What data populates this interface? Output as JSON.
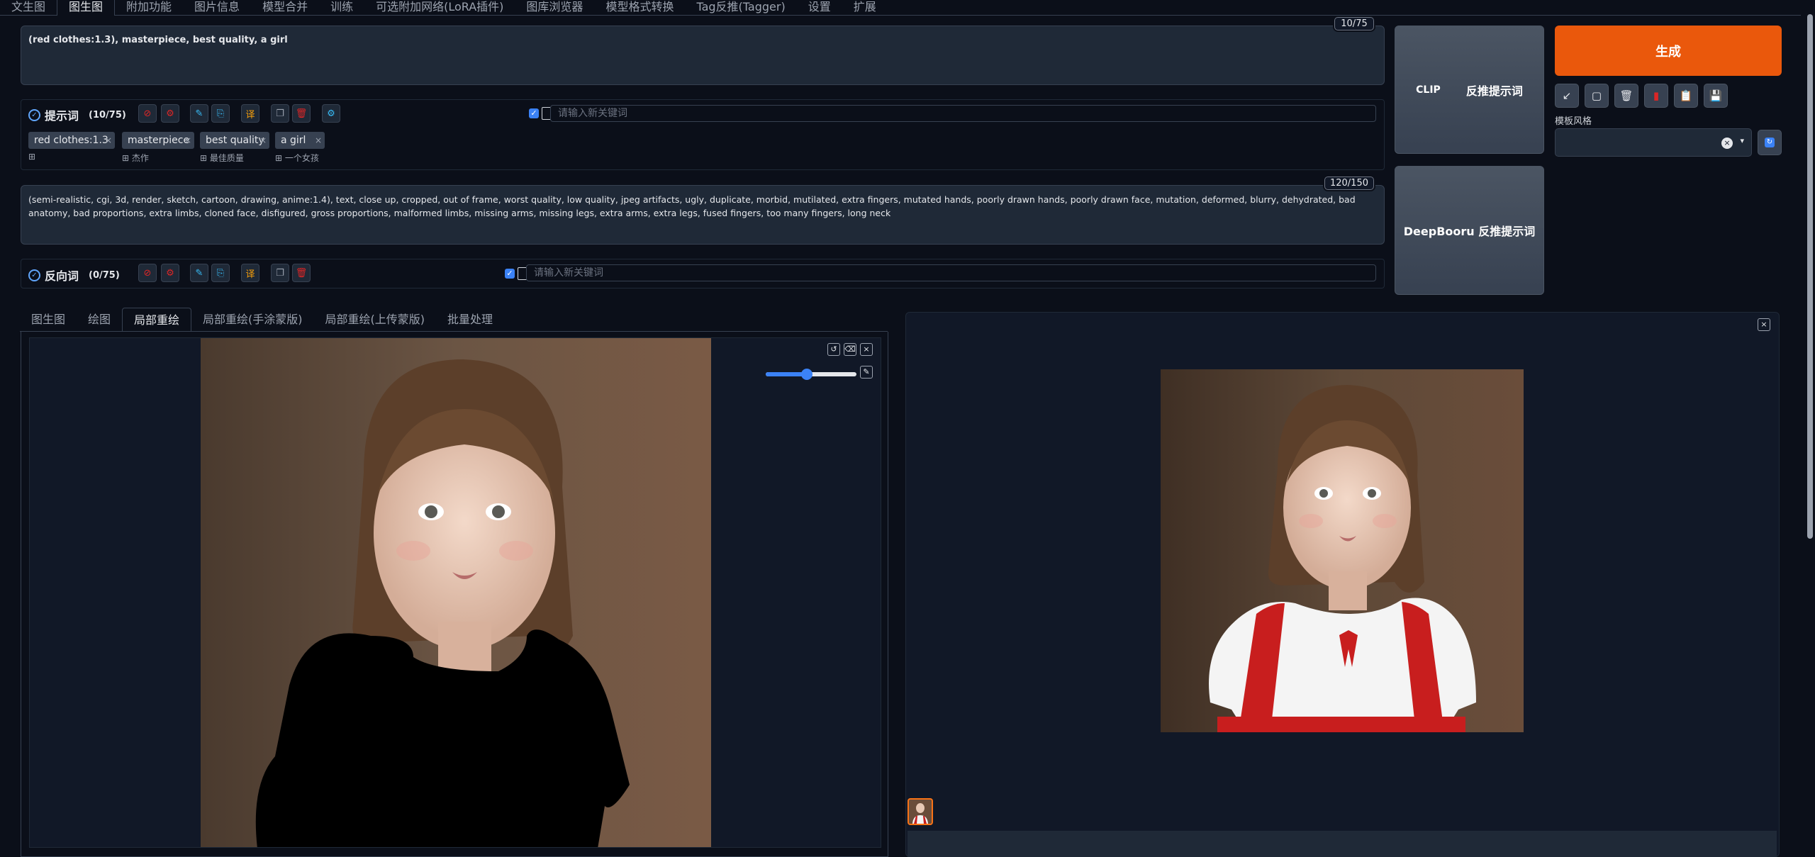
{
  "nav": {
    "tabs": [
      "文生图",
      "图生图",
      "附加功能",
      "图片信息",
      "模型合并",
      "训练",
      "可选附加网络(LoRA插件)",
      "图库浏览器",
      "模型格式转换",
      "Tag反推(Tagger)",
      "设置",
      "扩展"
    ],
    "active": "图生图"
  },
  "prompt": {
    "text": "(red clothes:1.3), masterpiece, best quality, a girl",
    "counter": "10/75",
    "title": "提示词",
    "count": "(10/75)",
    "keyword_placeholder": "请输入新关键词",
    "tags": [
      {
        "label": "red clothes:1.3",
        "translation": ""
      },
      {
        "label": "masterpiece",
        "translation": "杰作"
      },
      {
        "label": "best quality",
        "translation": "最佳质量"
      },
      {
        "label": "a girl",
        "translation": "一个女孩"
      }
    ]
  },
  "negative": {
    "text": "(semi-realistic, cgi, 3d, render, sketch, cartoon, drawing, anime:1.4), text, close up, cropped, out of frame, worst quality, low quality, jpeg artifacts, ugly, duplicate, morbid, mutilated, extra fingers, mutated hands, poorly drawn hands, poorly drawn face, mutation, deformed, blurry, dehydrated, bad anatomy, bad proportions, extra limbs, cloned face, disfigured, gross proportions, malformed limbs, missing arms, missing legs, extra arms, extra legs, fused fingers, too many fingers, long neck",
    "counter": "120/150",
    "title": "反向词",
    "count": "(0/75)",
    "keyword_placeholder": "请输入新关键词"
  },
  "interrogate": {
    "clip_label": "CLIP",
    "clip_sub": "反推提示词",
    "deepbooru_label": "DeepBooru 反推提示词"
  },
  "generate_label": "生成",
  "style": {
    "label": "模板风格",
    "value": ""
  },
  "tool_icons": [
    "arrow-icon",
    "paste-icon",
    "trash-icon",
    "bookmark-icon",
    "clipboard-icon",
    "save-icon"
  ],
  "subtabs": {
    "items": [
      "图生图",
      "绘图",
      "局部重绘",
      "局部重绘(手涂蒙版)",
      "局部重绘(上传蒙版)",
      "批量处理"
    ],
    "active": "局部重绘"
  },
  "brush_size_fraction": 0.45,
  "colors": {
    "accent": "#ea580c",
    "bg": "#0b0f19",
    "panel": "#1f2937"
  }
}
